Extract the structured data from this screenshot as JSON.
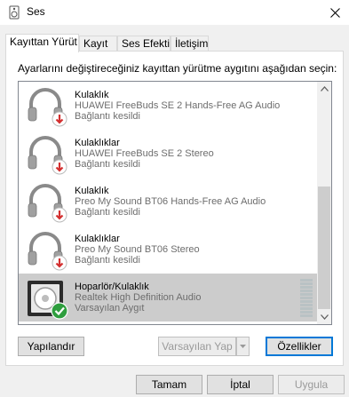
{
  "window": {
    "title": "Ses"
  },
  "tabs": [
    {
      "label": "Kayıttan Yürüt",
      "active": true
    },
    {
      "label": "Kayıt",
      "active": false
    },
    {
      "label": "Ses Efekti",
      "active": false
    },
    {
      "label": "İletişim",
      "active": false
    }
  ],
  "instruction": "Ayarlarını değiştireceğiniz kayıttan yürütme aygıtını aşağıdan seçin:",
  "devices": [
    {
      "name": "Kulaklık",
      "description": "HUAWEI FreeBuds SE 2 Hands-Free AG Audio",
      "status": "Bağlantı kesildi",
      "icon": "headphones-icon",
      "badge": "disconnected-arrow-icon"
    },
    {
      "name": "Kulaklıklar",
      "description": "HUAWEI FreeBuds SE 2 Stereo",
      "status": "Bağlantı kesildi",
      "icon": "headphones-icon",
      "badge": "disconnected-arrow-icon"
    },
    {
      "name": "Kulaklık",
      "description": "Preo My Sound BT06 Hands-Free AG Audio",
      "status": "Bağlantı kesildi",
      "icon": "headphones-icon",
      "badge": "disconnected-arrow-icon"
    },
    {
      "name": "Kulaklıklar",
      "description": "Preo My Sound BT06 Stereo",
      "status": "Bağlantı kesildi",
      "icon": "headphones-icon",
      "badge": "disconnected-arrow-icon"
    },
    {
      "name": "Hoparlör/Kulaklık",
      "description": "Realtek High Definition Audio",
      "status": "Varsayılan Aygıt",
      "icon": "speaker-icon",
      "badge": "default-check-icon",
      "selected": true
    }
  ],
  "buttons": {
    "configure": "Yapılandır",
    "set_default": "Varsayılan Yap",
    "properties": "Özellikler",
    "ok": "Tamam",
    "cancel": "İptal",
    "apply": "Uygula"
  },
  "colors": {
    "selection": "#cccccc",
    "disconnected_badge": "#d32f2f",
    "default_badge": "#2e9e3e",
    "default_button_border": "#0078d7"
  }
}
